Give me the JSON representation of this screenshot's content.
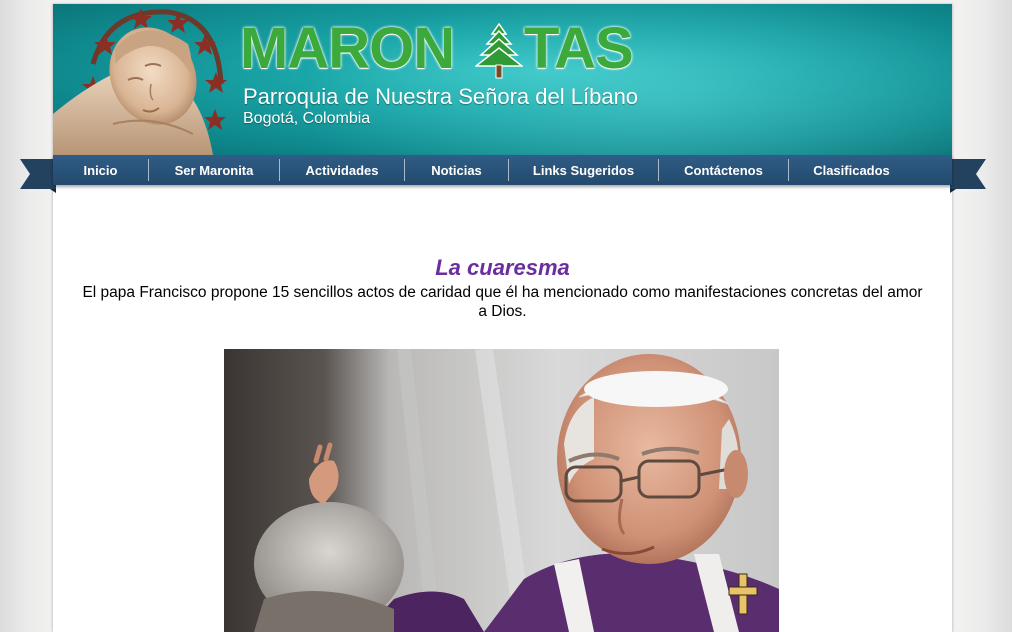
{
  "header": {
    "logo_part1": "MARON",
    "logo_part2": "TAS",
    "subtitle": "Parroquia de Nuestra Señora del Líbano",
    "location": "Bogotá, Colombia"
  },
  "nav": {
    "items": [
      {
        "label": "Inicio"
      },
      {
        "label": "Ser Maronita"
      },
      {
        "label": "Actividades"
      },
      {
        "label": "Noticias"
      },
      {
        "label": "Links Sugeridos"
      },
      {
        "label": "Contáctenos"
      },
      {
        "label": "Clasificados"
      }
    ]
  },
  "article": {
    "title": "La cuaresma",
    "intro": "El papa Francisco propone 15 sencillos actos de caridad que él ha mencionado como manifestaciones concretas del amor a Dios."
  },
  "colors": {
    "logo_green": "#3ba93b",
    "banner_teal": "#1aa6a8",
    "nav_blue": "#2f5d86",
    "title_purple": "#6a2e9e"
  }
}
